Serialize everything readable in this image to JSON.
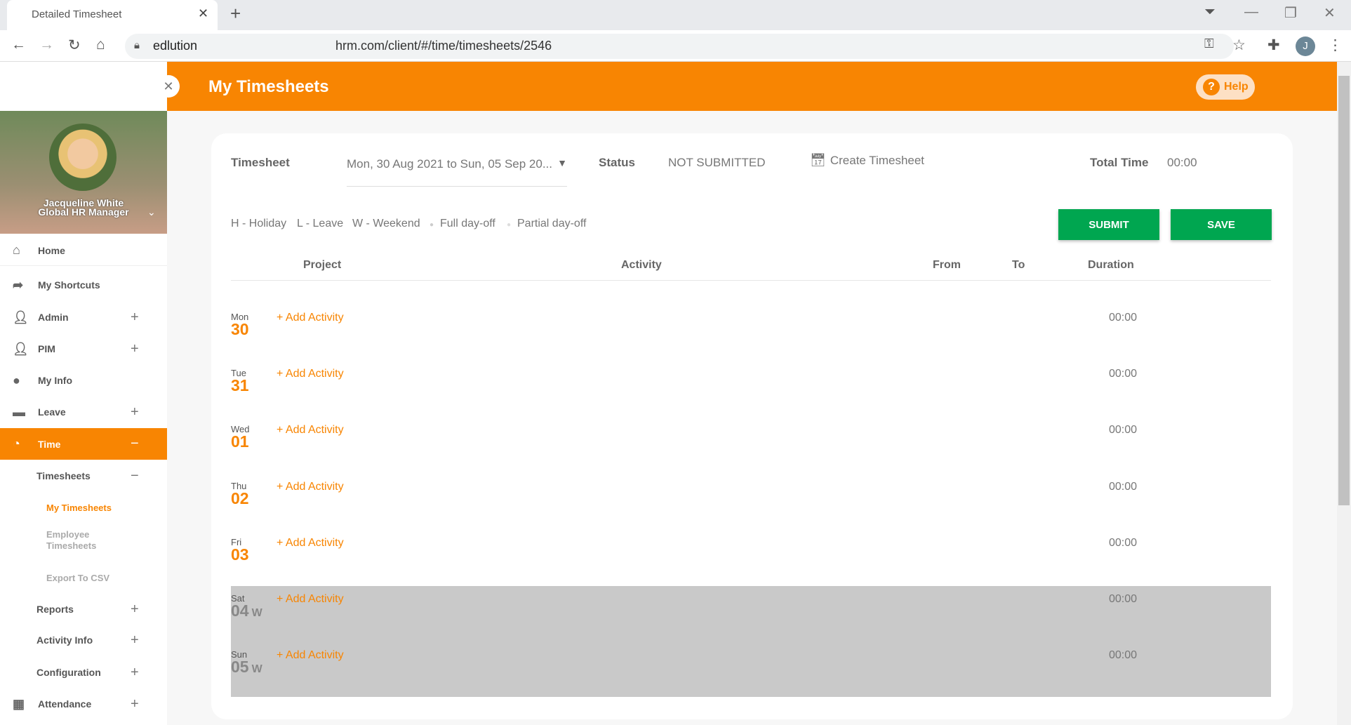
{
  "browser": {
    "tab_title": "Detailed Timesheet",
    "site": "edlution",
    "url": "hrm.com/client/#/time/timesheets/2546",
    "profile_initial": "J"
  },
  "header": {
    "title": "My Timesheets",
    "help": "Help"
  },
  "profile": {
    "name": "Jacqueline White",
    "role": "Global HR Manager"
  },
  "sidebar": {
    "items": [
      {
        "label": "Home"
      },
      {
        "label": "My Shortcuts"
      },
      {
        "label": "Admin"
      },
      {
        "label": "PIM"
      },
      {
        "label": "My Info"
      },
      {
        "label": "Leave"
      },
      {
        "label": "Time"
      }
    ],
    "time_sub": {
      "timesheets": "Timesheets",
      "my_timesheets": "My Timesheets",
      "employee_timesheets": "Employee Timesheets",
      "export": "Export To CSV",
      "reports": "Reports",
      "activity_info": "Activity Info",
      "configuration": "Configuration"
    },
    "attendance": "Attendance"
  },
  "timesheet": {
    "label": "Timesheet",
    "period": "Mon, 30 Aug 2021 to Sun, 05 Sep 20...",
    "status_label": "Status",
    "status": "NOT SUBMITTED",
    "create": "Create Timesheet",
    "total_label": "Total Time",
    "total": "00:00"
  },
  "legend": {
    "holiday": "H - Holiday",
    "leave": "L - Leave",
    "weekend": "W - Weekend",
    "full": "Full day-off",
    "partial": "Partial day-off"
  },
  "buttons": {
    "submit": "SUBMIT",
    "save": "SAVE"
  },
  "columns": {
    "project": "Project",
    "activity": "Activity",
    "from": "From",
    "to": "To",
    "duration": "Duration"
  },
  "add_label": "+ Add Activity",
  "days": [
    {
      "name": "Mon",
      "num": "30",
      "duration": "00:00"
    },
    {
      "name": "Tue",
      "num": "31",
      "duration": "00:00"
    },
    {
      "name": "Wed",
      "num": "01",
      "duration": "00:00"
    },
    {
      "name": "Thu",
      "num": "02",
      "duration": "00:00"
    },
    {
      "name": "Fri",
      "num": "03",
      "duration": "00:00"
    },
    {
      "name": "Sat",
      "num": "04",
      "tag": "W",
      "duration": "00:00"
    },
    {
      "name": "Sun",
      "num": "05",
      "tag": "W",
      "duration": "00:00"
    }
  ]
}
